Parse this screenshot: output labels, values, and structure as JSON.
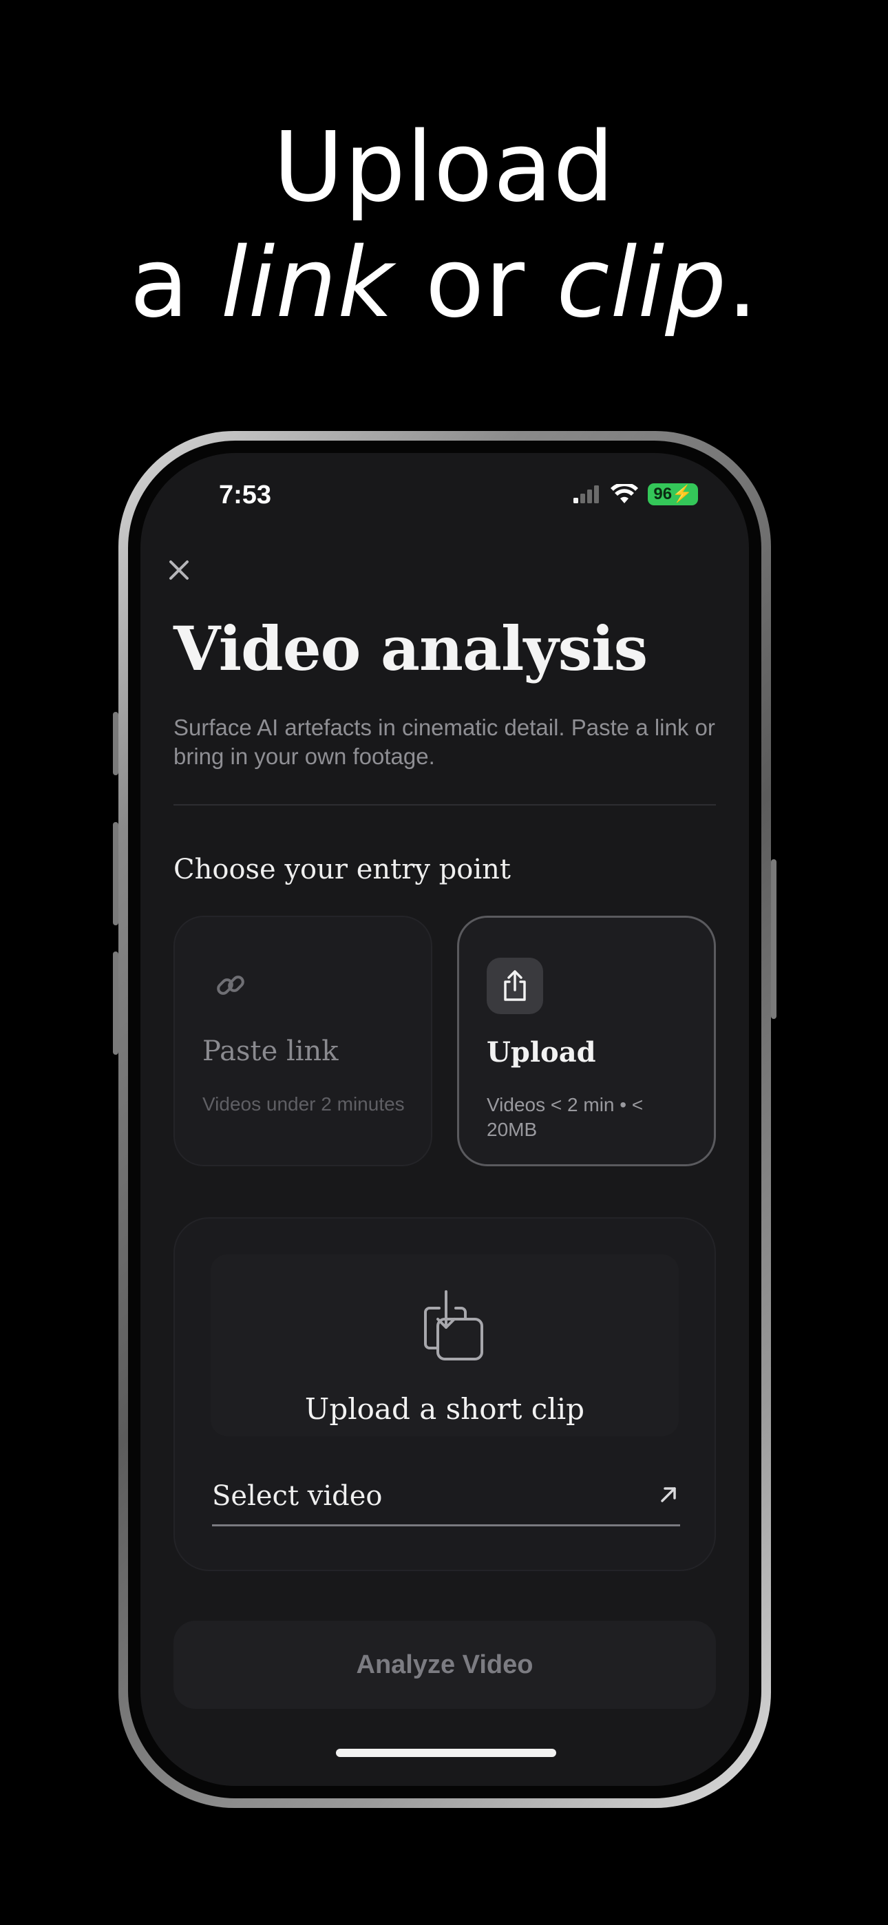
{
  "headline": {
    "line1": "Upload",
    "line2_a": "a ",
    "line2_link": "link",
    "line2_or": " or ",
    "line2_clip": "clip",
    "line2_period": "."
  },
  "status_bar": {
    "time": "7:53",
    "battery": "96"
  },
  "screen": {
    "close_icon": "x-icon",
    "title": "Video analysis",
    "subtitle": "Surface AI artefacts in cinematic detail. Paste a link or bring in your own footage.",
    "section_title": "Choose your entry point",
    "cards": {
      "paste": {
        "icon": "link-icon",
        "label": "Paste link",
        "desc": "Videos under 2 minutes",
        "selected": false
      },
      "upload": {
        "icon": "share-icon",
        "label": "Upload",
        "desc": "Videos < 2 min • < 20MB",
        "selected": true
      }
    },
    "upload_panel": {
      "icon": "import-video-icon",
      "label": "Upload a short clip",
      "select_label": "Select video",
      "select_icon": "arrow-up-right-icon"
    },
    "analyze_button": "Analyze Video"
  },
  "colors": {
    "background": "#000000",
    "screen_bg": "#18181a",
    "battery_green": "#34c759",
    "card_border_selected": "#5a5a5e",
    "muted_text": "#8f8f94"
  }
}
